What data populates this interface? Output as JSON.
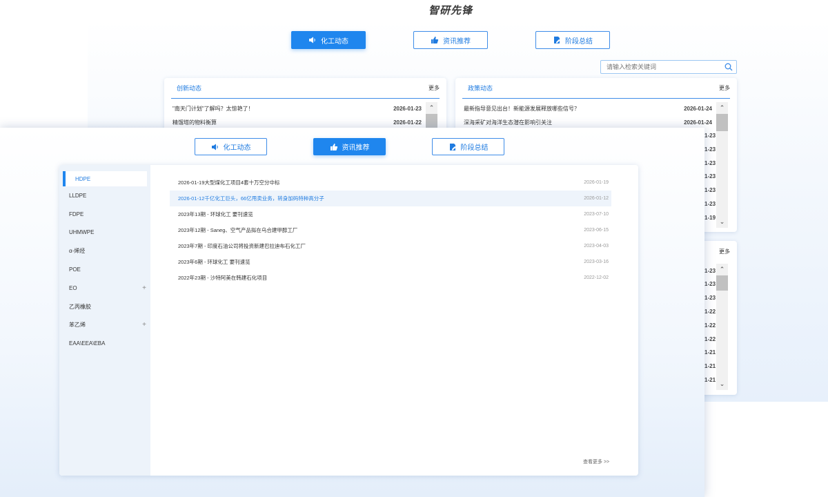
{
  "app_title": "智研先锋",
  "back": {
    "tabs": [
      {
        "label": "化工动态",
        "icon": "speaker-icon",
        "active": true
      },
      {
        "label": "资讯推荐",
        "icon": "thumbs-up-icon",
        "active": false
      },
      {
        "label": "阶段总结",
        "icon": "document-edit-icon",
        "active": false
      }
    ],
    "search": {
      "placeholder": "请输入检索关键词"
    },
    "cards": [
      {
        "title": "创新动态",
        "more": "更多",
        "rows": [
          {
            "title": "\"南天门计划\"了解吗？太惊艳了！",
            "date": "2026-01-23"
          },
          {
            "title": "精馏塔的物料衡算",
            "date": "2026-01-22"
          }
        ]
      },
      {
        "title": "政策动态",
        "more": "更多",
        "rows": [
          {
            "title": "最新指导意见出台！新能源发展释放哪些信号？",
            "date": "2026-01-24"
          },
          {
            "title": "深海采矿对海洋生态潜在影响引关注",
            "date": "2026-01-24"
          }
        ]
      }
    ],
    "peek_dates_upper": [
      "1-23",
      "1-23",
      "1-23",
      "1-23",
      "1-23",
      "1-23",
      "1-19"
    ],
    "second_more": "更多",
    "peek_dates_lower": [
      "1-23",
      "1-23",
      "1-23",
      "1-22",
      "1-22",
      "1-22",
      "1-21",
      "1-21",
      "1-21"
    ],
    "scroll_up": "⌃",
    "scroll_down": "⌄"
  },
  "front": {
    "tabs": [
      {
        "label": "化工动态",
        "icon": "speaker-icon",
        "active": false
      },
      {
        "label": "资讯推荐",
        "icon": "thumbs-up-icon",
        "active": true
      },
      {
        "label": "阶段总结",
        "icon": "document-edit-icon",
        "active": false
      }
    ],
    "sidebar": [
      {
        "label": "HDPE",
        "active": true,
        "plus": ""
      },
      {
        "label": "LLDPE",
        "active": false,
        "plus": ""
      },
      {
        "label": "FDPE",
        "active": false,
        "plus": ""
      },
      {
        "label": "UHMWPE",
        "active": false,
        "plus": ""
      },
      {
        "label": "α-烯烃",
        "active": false,
        "plus": ""
      },
      {
        "label": "POE",
        "active": false,
        "plus": ""
      },
      {
        "label": "EO",
        "active": false,
        "plus": "+"
      },
      {
        "label": "乙丙橡胶",
        "active": false,
        "plus": ""
      },
      {
        "label": "苯乙烯",
        "active": false,
        "plus": "+"
      },
      {
        "label": "EAA\\EEA\\EBA",
        "active": false,
        "plus": ""
      }
    ],
    "articles": [
      {
        "title": "2026-01-19大型煤化工项目4套十万空分中标",
        "date": "2026-01-19",
        "highlight": false
      },
      {
        "title": "2026-01-12千亿化工巨头，66亿甩卖业务，转身加码特种高分子",
        "date": "2026-01-12",
        "highlight": true
      },
      {
        "title": "2023年13期 - 环球化工 要刊速览",
        "date": "2023-07-10",
        "highlight": false
      },
      {
        "title": "2023年12期 - Saneg、空气产品拟在乌合建甲醇工厂",
        "date": "2023-06-15",
        "highlight": false
      },
      {
        "title": "2023年7期 - 印度石油公司将投资新建巴拉迪布石化工厂",
        "date": "2023-04-03",
        "highlight": false
      },
      {
        "title": "2023年6期 - 环球化工 要刊速览",
        "date": "2023-03-16",
        "highlight": false
      },
      {
        "title": "2022年23期 - 沙特阿美在韩建石化项目",
        "date": "2022-12-02",
        "highlight": false
      }
    ],
    "view_more": "查看更多 >>"
  },
  "colors": {
    "accent": "#1f86ee",
    "text": "#333333",
    "muted": "#999999",
    "sidebar_bg": "#edf3fa"
  }
}
